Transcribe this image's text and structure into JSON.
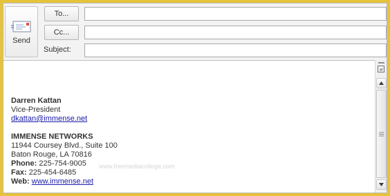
{
  "header": {
    "send_label": "Send",
    "to_label": "To...",
    "cc_label": "Cc...",
    "subject_label": "Subject:",
    "to_value": "",
    "cc_value": "",
    "subject_value": ""
  },
  "signature": {
    "name": "Darren Kattan",
    "title": "Vice-President",
    "email": "dkattan@immense.net",
    "company": "IMMENSE NETWORKS",
    "address1": "11944 Coursey Blvd., Suite 100",
    "address2": "Baton Rouge, LA 70816",
    "phone_label": "Phone:",
    "phone": "225-754-9005",
    "fax_label": "Fax:",
    "fax": "225-454-6485",
    "web_label": "Web:",
    "web": "www.immense.net"
  },
  "watermark": "www.freemediacollege.com",
  "icons": {
    "send": "envelope-send-icon",
    "scroll_up": "scroll-up-arrow-icon",
    "scroll_down": "scroll-down-arrow-icon",
    "ruler": "view-ruler-icon"
  },
  "colors": {
    "frame_background": "#e6c33a",
    "link": "#1a1aa8"
  }
}
